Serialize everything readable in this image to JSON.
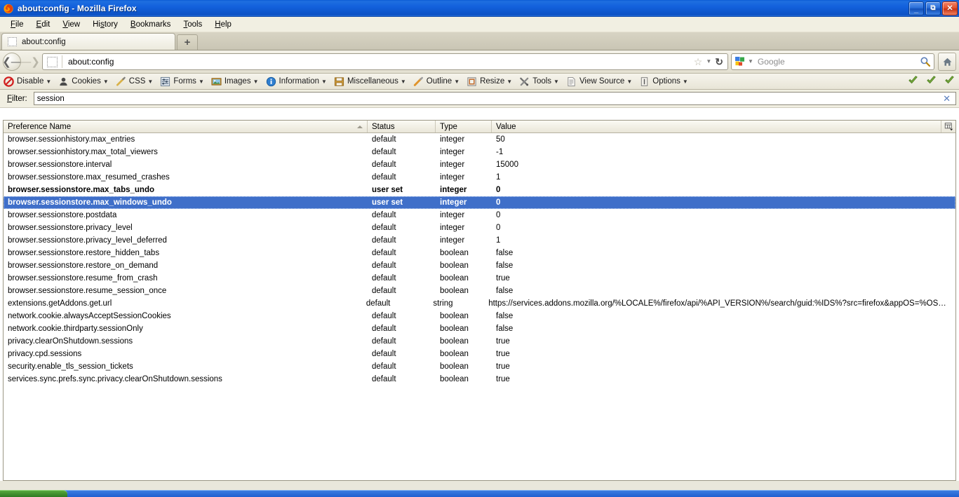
{
  "window": {
    "title": "about:config - Mozilla Firefox",
    "icon": "firefox-icon",
    "controls": {
      "minimize": "_",
      "restore": "❐",
      "close": "✕"
    }
  },
  "menubar": {
    "items": [
      {
        "label": "File",
        "accel": "F"
      },
      {
        "label": "Edit",
        "accel": "E"
      },
      {
        "label": "View",
        "accel": "V"
      },
      {
        "label": "History",
        "accel": "s"
      },
      {
        "label": "Bookmarks",
        "accel": "B"
      },
      {
        "label": "Tools",
        "accel": "T"
      },
      {
        "label": "Help",
        "accel": "H"
      }
    ]
  },
  "tabs": {
    "items": [
      {
        "label": "about:config",
        "favicon": "blank-favicon"
      }
    ],
    "new_tab_label": "+"
  },
  "navbar": {
    "back_icon": "back-arrow-icon",
    "forward_icon": "forward-arrow-icon",
    "url": "about:config",
    "identity_icon": "blank-identity-icon",
    "bookmark_star_icon": "star-icon",
    "reload_icon": "reload-icon",
    "search_engine": "google-icon",
    "search_placeholder": "Google",
    "search_go_icon": "magnifier-icon",
    "home_icon": "home-icon"
  },
  "devtoolbar": {
    "items": [
      {
        "label": "Disable",
        "icon": "disable-icon",
        "has_caret": true
      },
      {
        "label": "Cookies",
        "icon": "cookies-icon",
        "has_caret": true
      },
      {
        "label": "CSS",
        "icon": "css-icon",
        "has_caret": true
      },
      {
        "label": "Forms",
        "icon": "forms-icon",
        "has_caret": true
      },
      {
        "label": "Images",
        "icon": "images-icon",
        "has_caret": true
      },
      {
        "label": "Information",
        "icon": "information-icon",
        "has_caret": true
      },
      {
        "label": "Miscellaneous",
        "icon": "miscellaneous-icon",
        "has_caret": true
      },
      {
        "label": "Outline",
        "icon": "outline-icon",
        "has_caret": true
      },
      {
        "label": "Resize",
        "icon": "resize-icon",
        "has_caret": true
      },
      {
        "label": "Tools",
        "icon": "tools-icon",
        "has_caret": true
      },
      {
        "label": "View Source",
        "icon": "view-source-icon",
        "has_caret": true
      },
      {
        "label": "Options",
        "icon": "options-icon",
        "has_caret": true
      }
    ],
    "status_checks": [
      "check-icon",
      "check-icon",
      "check-icon"
    ]
  },
  "filter": {
    "label": "Filter:",
    "accel": "F",
    "value": "session",
    "clear_icon": "✕"
  },
  "table": {
    "columns": [
      {
        "key": "name",
        "label": "Preference Name",
        "sort": "asc"
      },
      {
        "key": "status",
        "label": "Status"
      },
      {
        "key": "type",
        "label": "Type"
      },
      {
        "key": "value",
        "label": "Value"
      }
    ],
    "column_picker_icon": "column-picker-icon",
    "selection": {
      "color": "#3f6fc9",
      "text_color": "#ffffff"
    },
    "rows": [
      {
        "name": "browser.sessionhistory.max_entries",
        "status": "default",
        "type": "integer",
        "value": "50",
        "bold": false,
        "selected": false
      },
      {
        "name": "browser.sessionhistory.max_total_viewers",
        "status": "default",
        "type": "integer",
        "value": "-1",
        "bold": false,
        "selected": false
      },
      {
        "name": "browser.sessionstore.interval",
        "status": "default",
        "type": "integer",
        "value": "15000",
        "bold": false,
        "selected": false
      },
      {
        "name": "browser.sessionstore.max_resumed_crashes",
        "status": "default",
        "type": "integer",
        "value": "1",
        "bold": false,
        "selected": false
      },
      {
        "name": "browser.sessionstore.max_tabs_undo",
        "status": "user set",
        "type": "integer",
        "value": "0",
        "bold": true,
        "selected": false
      },
      {
        "name": "browser.sessionstore.max_windows_undo",
        "status": "user set",
        "type": "integer",
        "value": "0",
        "bold": true,
        "selected": true
      },
      {
        "name": "browser.sessionstore.postdata",
        "status": "default",
        "type": "integer",
        "value": "0",
        "bold": false,
        "selected": false
      },
      {
        "name": "browser.sessionstore.privacy_level",
        "status": "default",
        "type": "integer",
        "value": "0",
        "bold": false,
        "selected": false
      },
      {
        "name": "browser.sessionstore.privacy_level_deferred",
        "status": "default",
        "type": "integer",
        "value": "1",
        "bold": false,
        "selected": false
      },
      {
        "name": "browser.sessionstore.restore_hidden_tabs",
        "status": "default",
        "type": "boolean",
        "value": "false",
        "bold": false,
        "selected": false
      },
      {
        "name": "browser.sessionstore.restore_on_demand",
        "status": "default",
        "type": "boolean",
        "value": "false",
        "bold": false,
        "selected": false
      },
      {
        "name": "browser.sessionstore.resume_from_crash",
        "status": "default",
        "type": "boolean",
        "value": "true",
        "bold": false,
        "selected": false
      },
      {
        "name": "browser.sessionstore.resume_session_once",
        "status": "default",
        "type": "boolean",
        "value": "false",
        "bold": false,
        "selected": false
      },
      {
        "name": "extensions.getAddons.get.url",
        "status": "default",
        "type": "string",
        "value": "https://services.addons.mozilla.org/%LOCALE%/firefox/api/%API_VERSION%/search/guid:%IDS%?src=firefox&appOS=%OS%&…",
        "bold": false,
        "selected": false
      },
      {
        "name": "network.cookie.alwaysAcceptSessionCookies",
        "status": "default",
        "type": "boolean",
        "value": "false",
        "bold": false,
        "selected": false
      },
      {
        "name": "network.cookie.thirdparty.sessionOnly",
        "status": "default",
        "type": "boolean",
        "value": "false",
        "bold": false,
        "selected": false
      },
      {
        "name": "privacy.clearOnShutdown.sessions",
        "status": "default",
        "type": "boolean",
        "value": "true",
        "bold": false,
        "selected": false
      },
      {
        "name": "privacy.cpd.sessions",
        "status": "default",
        "type": "boolean",
        "value": "true",
        "bold": false,
        "selected": false
      },
      {
        "name": "security.enable_tls_session_tickets",
        "status": "default",
        "type": "boolean",
        "value": "true",
        "bold": false,
        "selected": false
      },
      {
        "name": "services.sync.prefs.sync.privacy.clearOnShutdown.sessions",
        "status": "default",
        "type": "boolean",
        "value": "true",
        "bold": false,
        "selected": false
      }
    ]
  }
}
